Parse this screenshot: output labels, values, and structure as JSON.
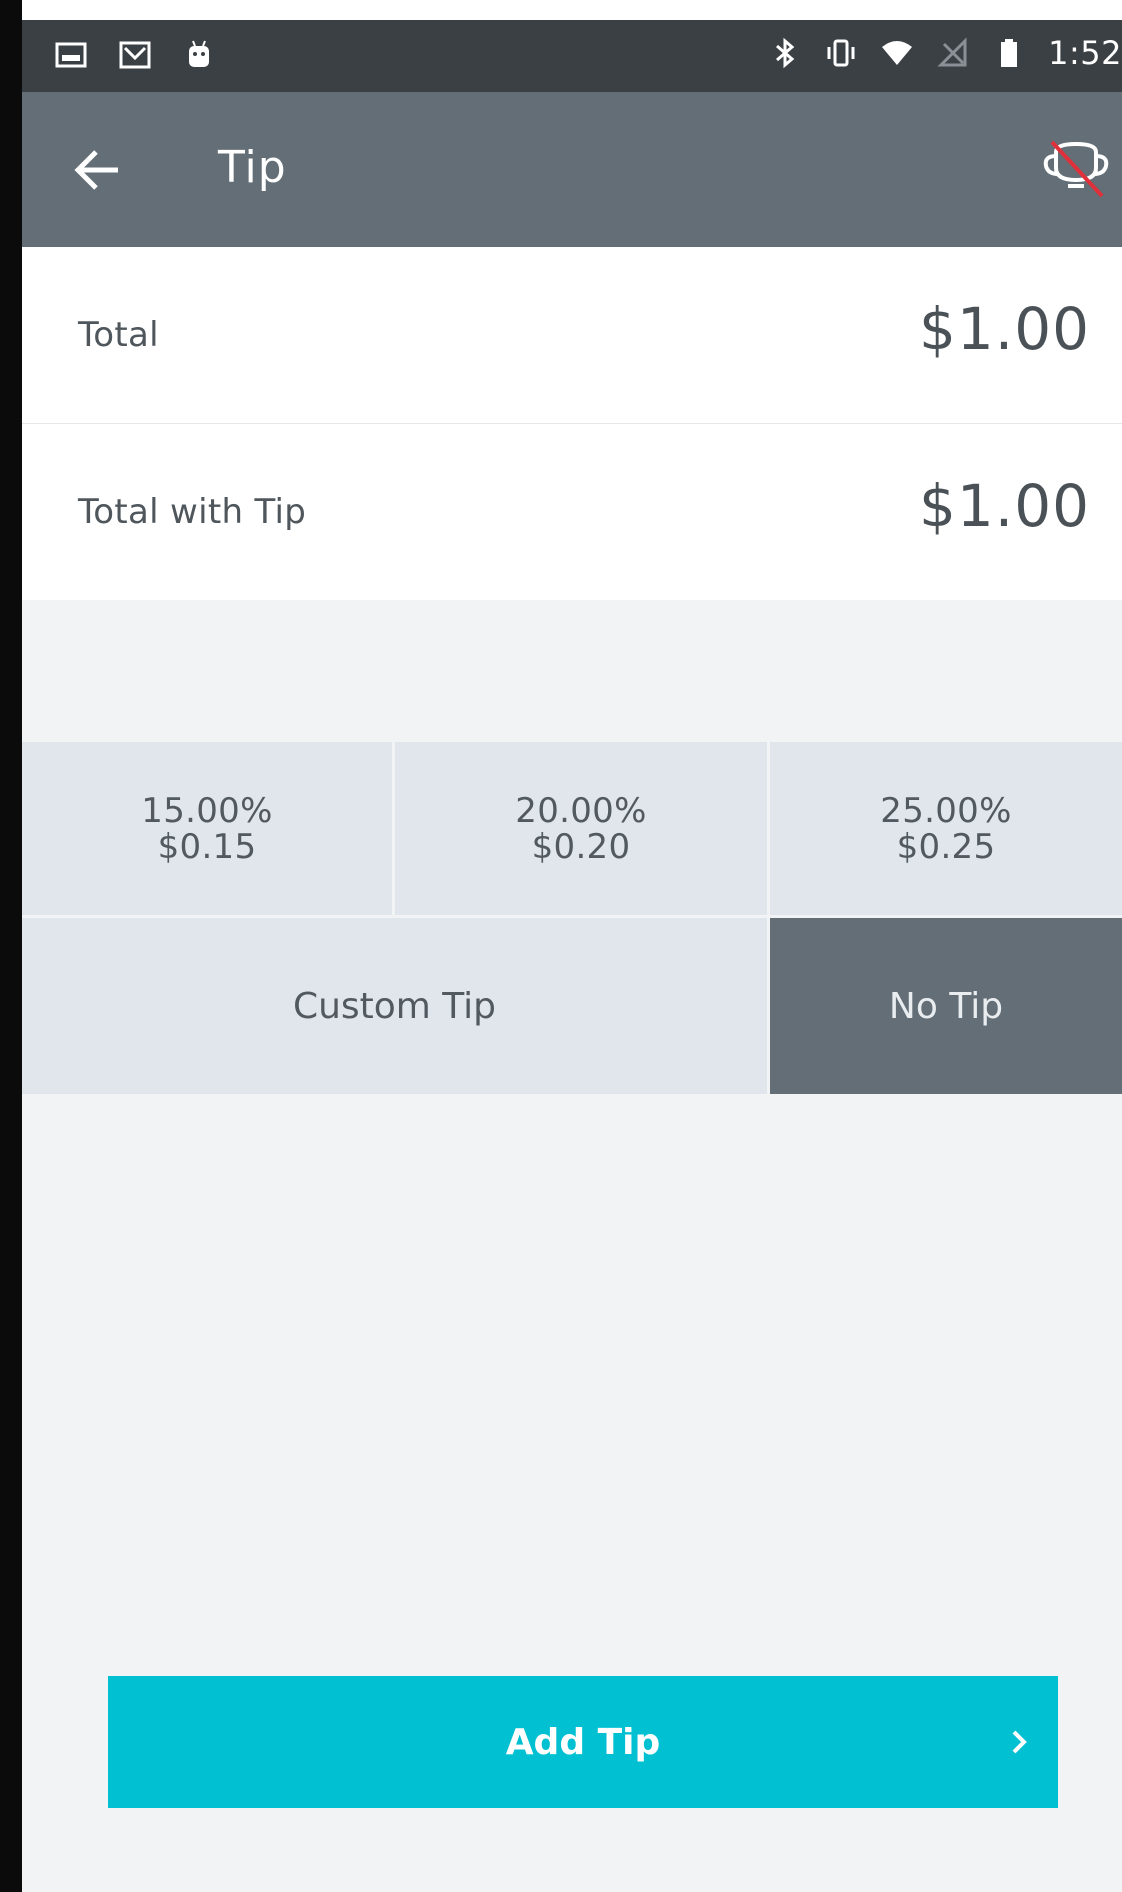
{
  "status_bar": {
    "time": "1:52",
    "left_icons": [
      "image-icon",
      "gmail-icon",
      "android-icon"
    ],
    "right_icons": [
      "bluetooth-icon",
      "vibrate-icon",
      "wifi-icon",
      "no-signal-icon",
      "battery-icon"
    ]
  },
  "app_bar": {
    "title": "Tip",
    "back_icon": "arrow-left-icon",
    "action_icon": "trophy-slashed-icon"
  },
  "totals": {
    "total_label": "Total",
    "total_value": "$1.00",
    "with_tip_label": "Total with Tip",
    "with_tip_value": "$1.00"
  },
  "tip_options": [
    {
      "percent": "15.00%",
      "amount": "$0.15"
    },
    {
      "percent": "20.00%",
      "amount": "$0.20"
    },
    {
      "percent": "25.00%",
      "amount": "$0.25"
    }
  ],
  "custom_tip_label": "Custom Tip",
  "no_tip_label": "No Tip",
  "add_tip": {
    "label": "Add Tip",
    "chevron_icon": "chevron-right-icon"
  },
  "colors": {
    "status_bar_bg": "#3b4045",
    "app_bar_bg": "#636e76",
    "tip_cell_bg": "#e1e6ec",
    "no_tip_selected_bg": "#636e76",
    "add_tip_bg": "#00c0d2",
    "screen_bg": "#f1f3f5"
  }
}
